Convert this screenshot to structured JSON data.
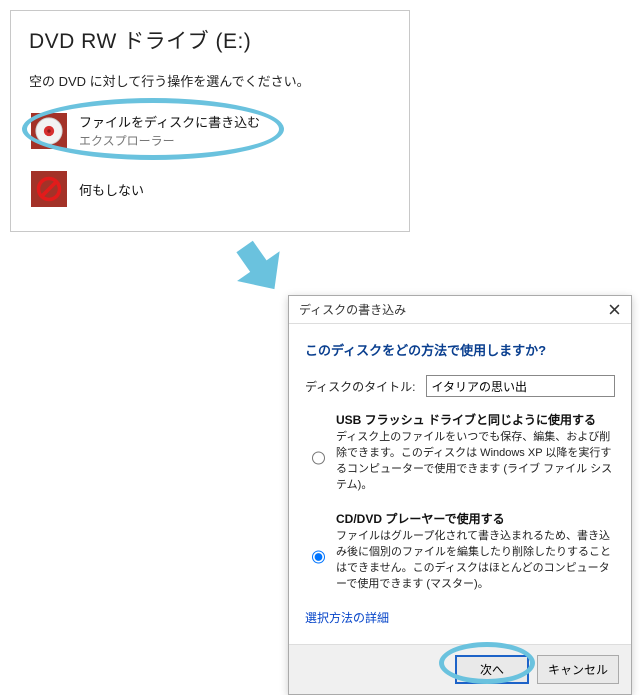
{
  "autoplay": {
    "title": "DVD RW ドライブ (E:)",
    "prompt": "空の DVD に対して行う操作を選んでください。",
    "options": [
      {
        "primary": "ファイルをディスクに書き込む",
        "secondary": "エクスプローラー",
        "icon": "disc"
      },
      {
        "primary": "何もしない",
        "secondary": "",
        "icon": "no-entry"
      }
    ]
  },
  "burn_dialog": {
    "window_title": "ディスクの書き込み",
    "heading": "このディスクをどの方法で使用しますか?",
    "title_field_label": "ディスクのタイトル:",
    "title_field_value": "イタリアの思い出",
    "options": [
      {
        "title": "USB フラッシュ ドライブと同じように使用する",
        "desc": "ディスク上のファイルをいつでも保存、編集、および削除できます。このディスクは Windows XP 以降を実行するコンピューターで使用できます (ライブ ファイル システム)。",
        "selected": false
      },
      {
        "title": "CD/DVD プレーヤーで使用する",
        "desc": "ファイルはグループ化されて書き込まれるため、書き込み後に個別のファイルを編集したり削除したりすることはできません。このディスクはほとんどのコンピューターで使用できます (マスター)。",
        "selected": true
      }
    ],
    "details_link": "選択方法の詳細",
    "buttons": {
      "next": "次へ",
      "cancel": "キャンセル"
    }
  },
  "annotation": {
    "highlight_color": "#6ac2de"
  }
}
